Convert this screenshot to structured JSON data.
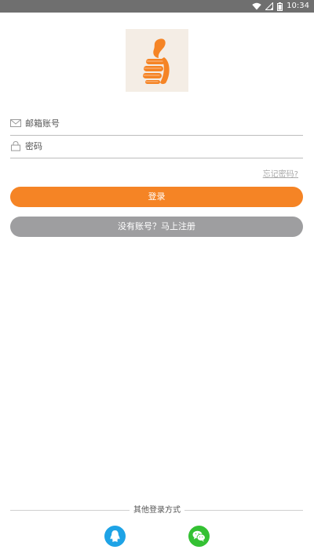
{
  "status_bar": {
    "time": "10:34",
    "icons": [
      "wifi-icon",
      "signal-icon",
      "battery-icon"
    ]
  },
  "logo": {
    "icon": "thumbs-up-logo-icon",
    "colors": {
      "background": "#f4ede5",
      "accent": "#f58425"
    }
  },
  "login_form": {
    "email_placeholder": "邮箱账号",
    "password_placeholder": "密码",
    "forgot_password": "忘记密码?",
    "login_button": "登录",
    "register_button": "没有账号？马上注册"
  },
  "other_login": {
    "title": "其他登录方式",
    "options": [
      {
        "icon": "qq-icon",
        "color": "#1ea3e6"
      },
      {
        "icon": "wechat-icon",
        "color": "#34c133"
      }
    ]
  },
  "colors": {
    "primary": "#f58425",
    "secondary_button": "#9e9ea0",
    "status_bar": "#6f6f6f"
  }
}
